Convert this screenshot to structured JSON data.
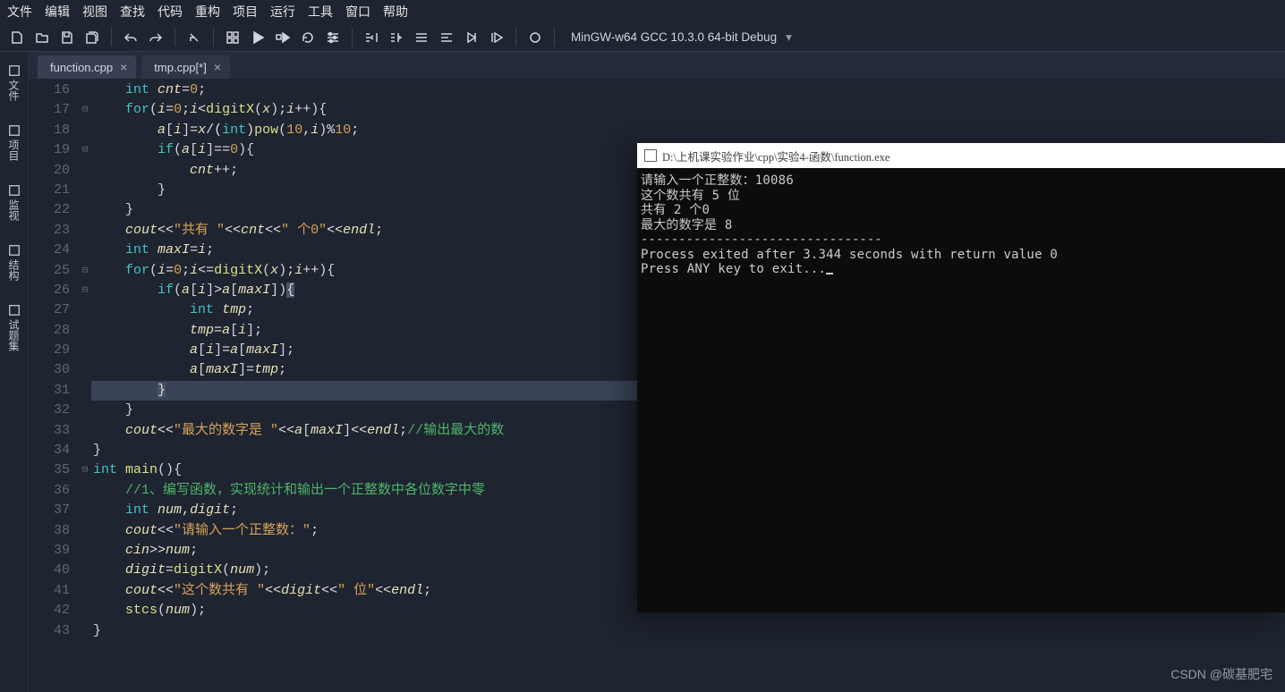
{
  "menu": [
    "文件",
    "编辑",
    "视图",
    "查找",
    "代码",
    "重构",
    "项目",
    "运行",
    "工具",
    "窗口",
    "帮助"
  ],
  "compiler": "MinGW-w64 GCC 10.3.0 64-bit Debug",
  "tabs": [
    {
      "label": "function.cpp",
      "dirty": false,
      "active": true
    },
    {
      "label": "tmp.cpp[*]",
      "dirty": true,
      "active": false
    }
  ],
  "rail": [
    "文件",
    "项目",
    "监视",
    "结构",
    "试题集"
  ],
  "editor": {
    "first_line": 16,
    "current_line": 31,
    "fold": {
      "17": "⊟",
      "19": "⊟",
      "25": "⊟",
      "26": "⊟",
      "35": "⊟"
    },
    "lines": [
      [
        [
          "    ",
          "pr"
        ],
        [
          "int",
          "ty"
        ],
        [
          " ",
          "pr"
        ],
        [
          "cnt",
          "id"
        ],
        [
          "=",
          "op"
        ],
        [
          "0",
          "nm"
        ],
        [
          ";",
          "op"
        ]
      ],
      [
        [
          "    ",
          "pr"
        ],
        [
          "for",
          "kw"
        ],
        [
          "(",
          "br"
        ],
        [
          "i",
          "id"
        ],
        [
          "=",
          "op"
        ],
        [
          "0",
          "nm"
        ],
        [
          ";",
          "op"
        ],
        [
          "i",
          "id"
        ],
        [
          "<",
          "op"
        ],
        [
          "digitX",
          "fn"
        ],
        [
          "(",
          "br"
        ],
        [
          "x",
          "id"
        ],
        [
          ")",
          "br"
        ],
        [
          ";",
          "op"
        ],
        [
          "i",
          "id"
        ],
        [
          "++",
          "op"
        ],
        [
          ")",
          "br"
        ],
        [
          "{",
          "br"
        ]
      ],
      [
        [
          "        ",
          "pr"
        ],
        [
          "a",
          "id"
        ],
        [
          "[",
          "br"
        ],
        [
          "i",
          "id"
        ],
        [
          "]",
          "br"
        ],
        [
          "=",
          "op"
        ],
        [
          "x",
          "id"
        ],
        [
          "/(",
          "op"
        ],
        [
          "int",
          "ty"
        ],
        [
          ")",
          "op"
        ],
        [
          "pow",
          "fn"
        ],
        [
          "(",
          "br"
        ],
        [
          "10",
          "nm"
        ],
        [
          ",",
          "op"
        ],
        [
          "i",
          "id"
        ],
        [
          ")",
          "br"
        ],
        [
          "%",
          "op"
        ],
        [
          "10",
          "nm"
        ],
        [
          ";",
          "op"
        ]
      ],
      [
        [
          "        ",
          "pr"
        ],
        [
          "if",
          "kw"
        ],
        [
          "(",
          "br"
        ],
        [
          "a",
          "id"
        ],
        [
          "[",
          "br"
        ],
        [
          "i",
          "id"
        ],
        [
          "]",
          "br"
        ],
        [
          "==",
          "op"
        ],
        [
          "0",
          "nm"
        ],
        [
          ")",
          "br"
        ],
        [
          "{",
          "br"
        ]
      ],
      [
        [
          "            ",
          "pr"
        ],
        [
          "cnt",
          "id"
        ],
        [
          "++",
          "op"
        ],
        [
          ";",
          "op"
        ]
      ],
      [
        [
          "        ",
          "pr"
        ],
        [
          "}",
          "br"
        ]
      ],
      [
        [
          "    ",
          "pr"
        ],
        [
          "}",
          "br"
        ]
      ],
      [
        [
          "    ",
          "pr"
        ],
        [
          "cout",
          "id"
        ],
        [
          "<<",
          "op"
        ],
        [
          "\"共有 \"",
          "st"
        ],
        [
          "<<",
          "op"
        ],
        [
          "cnt",
          "id"
        ],
        [
          "<<",
          "op"
        ],
        [
          "\" 个0\"",
          "st"
        ],
        [
          "<<",
          "op"
        ],
        [
          "endl",
          "id"
        ],
        [
          ";",
          "op"
        ]
      ],
      [
        [
          "    ",
          "pr"
        ],
        [
          "int",
          "ty"
        ],
        [
          " ",
          "pr"
        ],
        [
          "maxI",
          "id"
        ],
        [
          "=",
          "op"
        ],
        [
          "i",
          "id"
        ],
        [
          ";",
          "op"
        ]
      ],
      [
        [
          "    ",
          "pr"
        ],
        [
          "for",
          "kw"
        ],
        [
          "(",
          "br"
        ],
        [
          "i",
          "id"
        ],
        [
          "=",
          "op"
        ],
        [
          "0",
          "nm"
        ],
        [
          ";",
          "op"
        ],
        [
          "i",
          "id"
        ],
        [
          "<=",
          "op"
        ],
        [
          "digitX",
          "fn"
        ],
        [
          "(",
          "br"
        ],
        [
          "x",
          "id"
        ],
        [
          ")",
          "br"
        ],
        [
          ";",
          "op"
        ],
        [
          "i",
          "id"
        ],
        [
          "++",
          "op"
        ],
        [
          ")",
          "br"
        ],
        [
          "{",
          "br"
        ]
      ],
      [
        [
          "        ",
          "pr"
        ],
        [
          "if",
          "kw"
        ],
        [
          "(",
          "br"
        ],
        [
          "a",
          "id"
        ],
        [
          "[",
          "br"
        ],
        [
          "i",
          "id"
        ],
        [
          "]",
          "br"
        ],
        [
          ">",
          "op"
        ],
        [
          "a",
          "id"
        ],
        [
          "[",
          "br"
        ],
        [
          "maxI",
          "id"
        ],
        [
          "]",
          "br"
        ],
        [
          ")",
          "br"
        ],
        [
          "{",
          "cursor-bracket"
        ]
      ],
      [
        [
          "            ",
          "pr"
        ],
        [
          "int",
          "ty"
        ],
        [
          " ",
          "pr"
        ],
        [
          "tmp",
          "id"
        ],
        [
          ";",
          "op"
        ]
      ],
      [
        [
          "            ",
          "pr"
        ],
        [
          "tmp",
          "id"
        ],
        [
          "=",
          "op"
        ],
        [
          "a",
          "id"
        ],
        [
          "[",
          "br"
        ],
        [
          "i",
          "id"
        ],
        [
          "]",
          "br"
        ],
        [
          ";",
          "op"
        ]
      ],
      [
        [
          "            ",
          "pr"
        ],
        [
          "a",
          "id"
        ],
        [
          "[",
          "br"
        ],
        [
          "i",
          "id"
        ],
        [
          "]",
          "br"
        ],
        [
          "=",
          "op"
        ],
        [
          "a",
          "id"
        ],
        [
          "[",
          "br"
        ],
        [
          "maxI",
          "id"
        ],
        [
          "]",
          "br"
        ],
        [
          ";",
          "op"
        ]
      ],
      [
        [
          "            ",
          "pr"
        ],
        [
          "a",
          "id"
        ],
        [
          "[",
          "br"
        ],
        [
          "maxI",
          "id"
        ],
        [
          "]",
          "br"
        ],
        [
          "=",
          "op"
        ],
        [
          "tmp",
          "id"
        ],
        [
          ";",
          "op"
        ]
      ],
      [
        [
          "        ",
          "pr"
        ],
        [
          "}",
          "cursor-bracket"
        ]
      ],
      [
        [
          "    ",
          "pr"
        ],
        [
          "}",
          "br"
        ]
      ],
      [
        [
          "    ",
          "pr"
        ],
        [
          "cout",
          "id"
        ],
        [
          "<<",
          "op"
        ],
        [
          "\"最大的数字是 \"",
          "st"
        ],
        [
          "<<",
          "op"
        ],
        [
          "a",
          "id"
        ],
        [
          "[",
          "br"
        ],
        [
          "maxI",
          "id"
        ],
        [
          "]",
          "br"
        ],
        [
          "<<",
          "op"
        ],
        [
          "endl",
          "id"
        ],
        [
          ";",
          "op"
        ],
        [
          "//输出最大的数",
          "cm"
        ]
      ],
      [
        [
          "}",
          "br"
        ]
      ],
      [
        [
          "int",
          "ty"
        ],
        [
          " ",
          "pr"
        ],
        [
          "main",
          "fn"
        ],
        [
          "()",
          "br"
        ],
        [
          "{",
          "br"
        ]
      ],
      [
        [
          "    ",
          "pr"
        ],
        [
          "//1、编写函数，实现统计和输出一个正整数中各位数字中零",
          "cm"
        ]
      ],
      [
        [
          "    ",
          "pr"
        ],
        [
          "int",
          "ty"
        ],
        [
          " ",
          "pr"
        ],
        [
          "num",
          "id"
        ],
        [
          ",",
          "op"
        ],
        [
          "digit",
          "id"
        ],
        [
          ";",
          "op"
        ]
      ],
      [
        [
          "    ",
          "pr"
        ],
        [
          "cout",
          "id"
        ],
        [
          "<<",
          "op"
        ],
        [
          "\"请输入一个正整数：\"",
          "st"
        ],
        [
          ";",
          "op"
        ]
      ],
      [
        [
          "    ",
          "pr"
        ],
        [
          "cin",
          "id"
        ],
        [
          ">>",
          "op"
        ],
        [
          "num",
          "id"
        ],
        [
          ";",
          "op"
        ]
      ],
      [
        [
          "    ",
          "pr"
        ],
        [
          "digit",
          "id"
        ],
        [
          "=",
          "op"
        ],
        [
          "digitX",
          "fn"
        ],
        [
          "(",
          "br"
        ],
        [
          "num",
          "id"
        ],
        [
          ")",
          "br"
        ],
        [
          ";",
          "op"
        ]
      ],
      [
        [
          "    ",
          "pr"
        ],
        [
          "cout",
          "id"
        ],
        [
          "<<",
          "op"
        ],
        [
          "\"这个数共有 \"",
          "st"
        ],
        [
          "<<",
          "op"
        ],
        [
          "digit",
          "id"
        ],
        [
          "<<",
          "op"
        ],
        [
          "\" 位\"",
          "st"
        ],
        [
          "<<",
          "op"
        ],
        [
          "endl",
          "id"
        ],
        [
          ";",
          "op"
        ]
      ],
      [
        [
          "    ",
          "pr"
        ],
        [
          "stcs",
          "fn"
        ],
        [
          "(",
          "br"
        ],
        [
          "num",
          "id"
        ],
        [
          ")",
          "br"
        ],
        [
          ";",
          "op"
        ]
      ],
      [
        [
          "}",
          "br"
        ]
      ]
    ]
  },
  "console": {
    "title": "D:\\上机课实验作业\\cpp\\实验4-函数\\function.exe",
    "out": [
      "请输入一个正整数：10086",
      "这个数共有 5 位",
      "共有 2 个0",
      "最大的数字是 8",
      "",
      "--------------------------------",
      "Process exited after 3.344 seconds with return value 0",
      "",
      "Press ANY key to exit..."
    ]
  },
  "watermark": "CSDN @碳基肥宅"
}
